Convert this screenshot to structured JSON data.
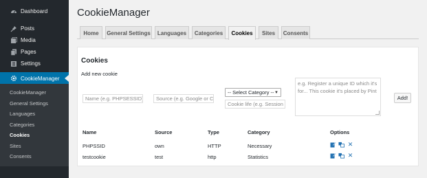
{
  "sidebar": {
    "items": [
      {
        "label": "Dashboard",
        "icon": "dashboard-icon"
      },
      {
        "label": "Posts",
        "icon": "pin-icon"
      },
      {
        "label": "Media",
        "icon": "media-icon"
      },
      {
        "label": "Pages",
        "icon": "pages-icon"
      },
      {
        "label": "Settings",
        "icon": "settings-icon"
      },
      {
        "label": "CookieManager",
        "icon": "gear-icon"
      }
    ],
    "submenu": [
      "CookieManager",
      "General Settings",
      "Languages",
      "Categories",
      "Cookies",
      "Sites",
      "Consents"
    ],
    "colors": {
      "bg": "#23282d",
      "active": "#0073aa",
      "submenu_bg": "#32373c"
    }
  },
  "header": {
    "title": "CookieManager"
  },
  "tabs": [
    "Home",
    "General Settings",
    "Languages",
    "Categories",
    "Cookies",
    "Sites",
    "Consents"
  ],
  "active_tab": "Cookies",
  "section": {
    "title": "Cookies",
    "add_label": "Add new cookie"
  },
  "form": {
    "name_placeholder": "Name (e.g. PHPSESSID)",
    "source_placeholder": "Source (e.g. Google or C",
    "category_selected": "-- Select Category --",
    "life_placeholder": "Cookie life (e.g. Session -",
    "description_placeholder": "e.g. Register a unique ID which it's for... This cookie it's placed by Pint",
    "add_button": "Add!"
  },
  "table": {
    "headers": [
      "Name",
      "Source",
      "Type",
      "Category",
      "Options"
    ],
    "rows": [
      [
        "PHPSSID",
        "own",
        "HTTP",
        "Necessary"
      ],
      [
        "testcookie",
        "test",
        "http",
        "Statistics"
      ]
    ],
    "option_icons": [
      "edit-icon",
      "translate-icon",
      "delete-icon"
    ]
  }
}
